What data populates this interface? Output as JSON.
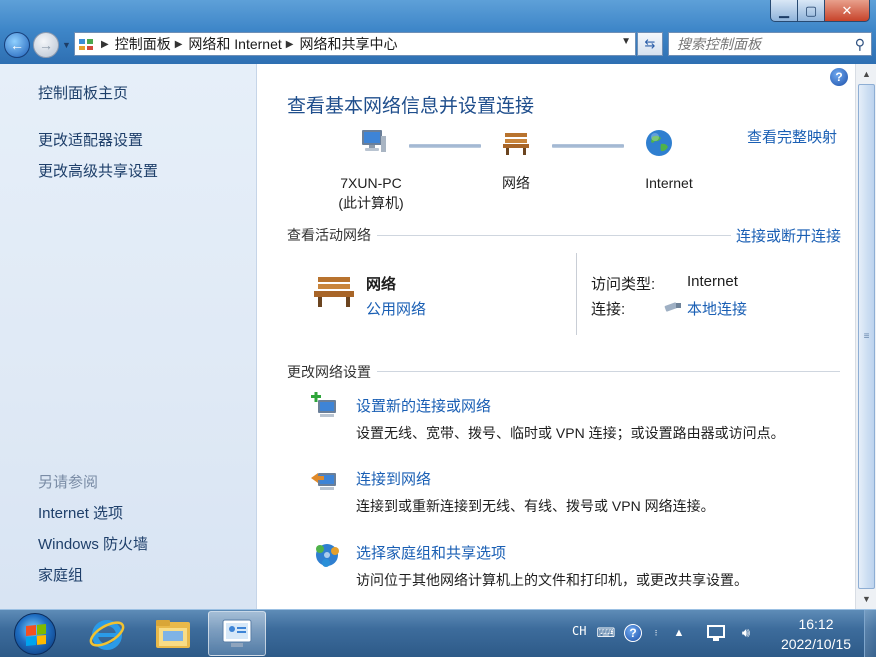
{
  "address": {
    "breadcrumbs": [
      "控制面板",
      "网络和 Internet",
      "网络和共享中心"
    ],
    "search_placeholder": "搜索控制面板"
  },
  "sidebar": {
    "top_links": [
      "控制面板主页",
      "更改适配器设置",
      "更改高级共享设置"
    ],
    "see_also_label": "另请参阅",
    "see_also_links": [
      "Internet 选项",
      "Windows 防火墙",
      "家庭组"
    ]
  },
  "main": {
    "title": "查看基本网络信息并设置连接",
    "full_map_link": "查看完整映射",
    "map": {
      "computer_name": "7XUN-PC",
      "computer_sub": "(此计算机)",
      "network": "网络",
      "internet": "Internet"
    },
    "active": {
      "section_title": "查看活动网络",
      "connect_link": "连接或断开连接",
      "network_name": "网络",
      "network_type": "公用网络",
      "access_type_label": "访问类型:",
      "access_type_value": "Internet",
      "connections_label": "连接:",
      "connections_value": "本地连接"
    },
    "change": {
      "section_title": "更改网络设置",
      "tasks": [
        {
          "title": "设置新的连接或网络",
          "desc": "设置无线、宽带、拨号、临时或 VPN 连接；或设置路由器或访问点。"
        },
        {
          "title": "连接到网络",
          "desc": "连接到或重新连接到无线、有线、拨号或 VPN 网络连接。"
        },
        {
          "title": "选择家庭组和共享选项",
          "desc": "访问位于其他网络计算机上的文件和打印机，或更改共享设置。"
        }
      ]
    }
  },
  "taskbar": {
    "lang": "CH",
    "time": "16:12",
    "date": "2022/10/15"
  },
  "colors": {
    "link": "#1a5fb4",
    "title": "#1f4e8c",
    "sidebar_bg": "#dfe9f5",
    "taskbar": "#3d6c9c"
  },
  "icons": [
    "back-arrow-icon",
    "forward-arrow-icon",
    "control-panel-icon",
    "refresh-icon",
    "search-icon",
    "help-icon",
    "computer-icon",
    "bench-network-icon",
    "globe-icon",
    "network-cable-icon",
    "new-connection-icon",
    "connect-network-icon",
    "homegroup-icon",
    "windows-start-icon",
    "internet-explorer-icon",
    "folder-icon",
    "network-center-icon",
    "keyboard-icon",
    "help-tray-icon",
    "show-hidden-icons-icon",
    "network-tray-icon",
    "volume-icon"
  ]
}
